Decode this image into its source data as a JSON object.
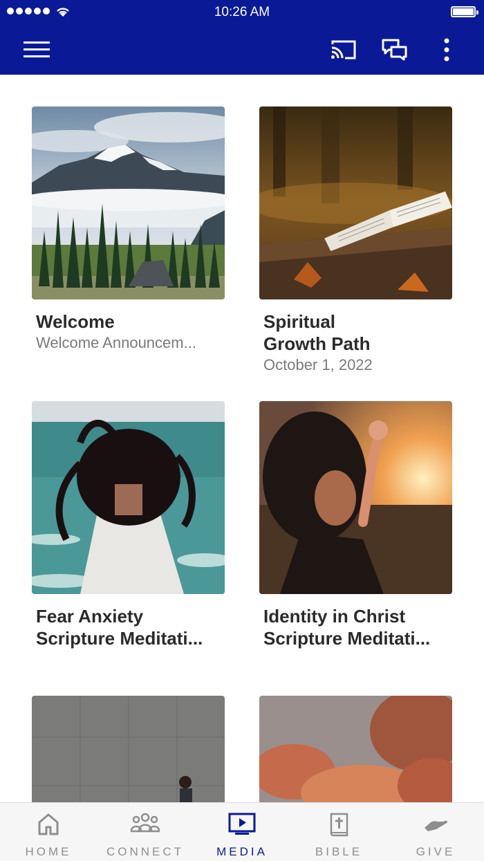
{
  "status_bar": {
    "time": "10:26 AM"
  },
  "header": {
    "menu_icon": "hamburger-icon",
    "actions": [
      "cast-icon",
      "chat-icon",
      "more-vertical-icon"
    ]
  },
  "media": [
    {
      "title": "Welcome",
      "subtitle": "Welcome Announcem..."
    },
    {
      "title": "Spiritual\nGrowth Path",
      "subtitle": "October 1, 2022"
    },
    {
      "title": "Fear Anxiety\nScripture Meditati...",
      "subtitle": ""
    },
    {
      "title": "Identity in Christ\nScripture Meditati...",
      "subtitle": ""
    },
    {
      "title": "",
      "subtitle": ""
    },
    {
      "title": "",
      "subtitle": ""
    }
  ],
  "tabs": [
    {
      "label": "HOME",
      "icon": "home-icon",
      "active": false
    },
    {
      "label": "CONNECT",
      "icon": "people-icon",
      "active": false
    },
    {
      "label": "MEDIA",
      "icon": "tv-play-icon",
      "active": true
    },
    {
      "label": "BIBLE",
      "icon": "bible-icon",
      "active": false
    },
    {
      "label": "GIVE",
      "icon": "give-hand-icon",
      "active": false
    }
  ],
  "colors": {
    "brand": "#0a1a96",
    "inactive_tab": "#8e8e8e"
  }
}
